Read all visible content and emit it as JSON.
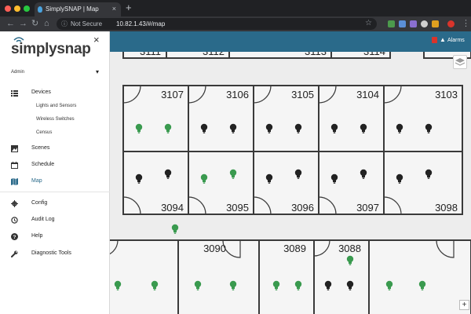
{
  "browser": {
    "tab_title": "SimplySNAP | Map",
    "tab_close": "×",
    "new_tab": "+",
    "not_secure": "Not Secure",
    "url": "10.82.1.43/#/map",
    "back": "←",
    "forward": "→",
    "reload": "↻",
    "home": "⌂",
    "star": "☆",
    "menu": "⋮"
  },
  "sidebar": {
    "logo": "simplysnap",
    "close": "×",
    "user": "Admin",
    "user_caret": "▾",
    "items": [
      {
        "label": "Devices",
        "icon": "list-icon"
      },
      {
        "label": "Scenes",
        "icon": "image-icon"
      },
      {
        "label": "Schedule",
        "icon": "calendar-icon"
      },
      {
        "label": "Map",
        "icon": "map-icon"
      },
      {
        "label": "Config",
        "icon": "gear-icon"
      },
      {
        "label": "Audit Log",
        "icon": "history-icon"
      },
      {
        "label": "Help",
        "icon": "help-icon"
      },
      {
        "label": "Diagnostic Tools",
        "icon": "wrench-icon"
      }
    ],
    "sub_items": [
      "Lights and Sensors",
      "Wireless Switches",
      "Census"
    ]
  },
  "header": {
    "alarms_label": "Alarms",
    "bell": "🔔"
  },
  "map": {
    "zoom_in": "+",
    "rooms_top_partial": [
      "3111",
      "3112",
      "3113",
      "3114"
    ],
    "rooms_row1": [
      "3107",
      "3106",
      "3105",
      "3104",
      "3103"
    ],
    "rooms_row2": [
      "3094",
      "3095",
      "3096",
      "3097",
      "3098"
    ],
    "rooms_row3": [
      "3090",
      "3089",
      "3088"
    ],
    "colors": {
      "light_on": "#3a9a4f",
      "light_off": "#222222"
    }
  }
}
